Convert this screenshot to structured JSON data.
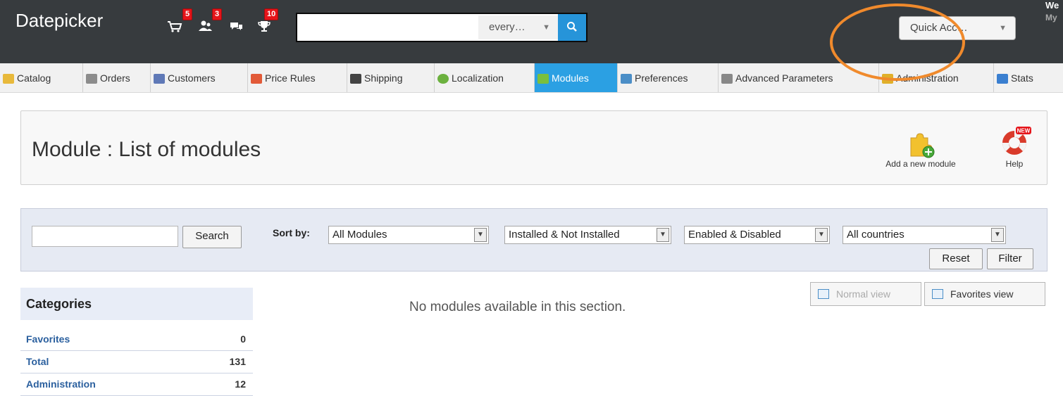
{
  "header": {
    "logo": "Datepicker",
    "notifications": [
      {
        "name": "orders",
        "count": "5"
      },
      {
        "name": "customers",
        "count": "3"
      },
      {
        "name": "messages",
        "count": ""
      },
      {
        "name": "achievements",
        "count": "10"
      }
    ],
    "search": {
      "value": "",
      "scope": "every…"
    },
    "quick_access": "Quick Acc…",
    "welcome": "We",
    "my_prefs": "My"
  },
  "nav": {
    "items": [
      {
        "label": "Catalog",
        "icon": "folder-icon",
        "color": "#e8b93b"
      },
      {
        "label": "Orders",
        "icon": "cart-icon",
        "color": "#8c8c8c"
      },
      {
        "label": "Customers",
        "icon": "customer-icon",
        "color": "#5f79b7"
      },
      {
        "label": "Price Rules",
        "icon": "price-tag-icon",
        "color": "#e25a38"
      },
      {
        "label": "Shipping",
        "icon": "truck-icon",
        "color": "#444444"
      },
      {
        "label": "Localization",
        "icon": "globe-icon",
        "color": "#6cb13f"
      },
      {
        "label": "Modules",
        "icon": "puzzle-icon",
        "color": "#7bbf3d"
      },
      {
        "label": "Preferences",
        "icon": "preferences-icon",
        "color": "#4b8ec7"
      },
      {
        "label": "Advanced Parameters",
        "icon": "wrench-icon",
        "color": "#888888"
      },
      {
        "label": "Administration",
        "icon": "key-icon",
        "color": "#e0b02a"
      },
      {
        "label": "Stats",
        "icon": "bar-chart-icon",
        "color": "#3a7fd0"
      }
    ],
    "active": "Modules"
  },
  "toolbar": {
    "title": "Module : List of modules",
    "add_module_label": "Add a new module",
    "help_label": "Help",
    "help_badge": "NEW"
  },
  "filters": {
    "search_value": "",
    "search_button": "Search",
    "sort_by_label": "Sort by:",
    "module_type": "All Modules",
    "install_status": "Installed & Not Installed",
    "enable_status": "Enabled & Disabled",
    "country": "All countries",
    "reset_button": "Reset",
    "filter_button": "Filter"
  },
  "sidebar": {
    "header": "Categories",
    "categories": [
      {
        "label": "Favorites",
        "count": "0"
      },
      {
        "label": "Total",
        "count": "131"
      },
      {
        "label": "Administration",
        "count": "12"
      }
    ]
  },
  "main": {
    "empty_message": "No modules available in this section.",
    "normal_view": "Normal view",
    "favorites_view": "Favorites view"
  },
  "colors": {
    "header_bg": "#373b3e",
    "accent": "#2ba0e3",
    "highlight": "#f08a2c",
    "badge": "#e5141a"
  }
}
